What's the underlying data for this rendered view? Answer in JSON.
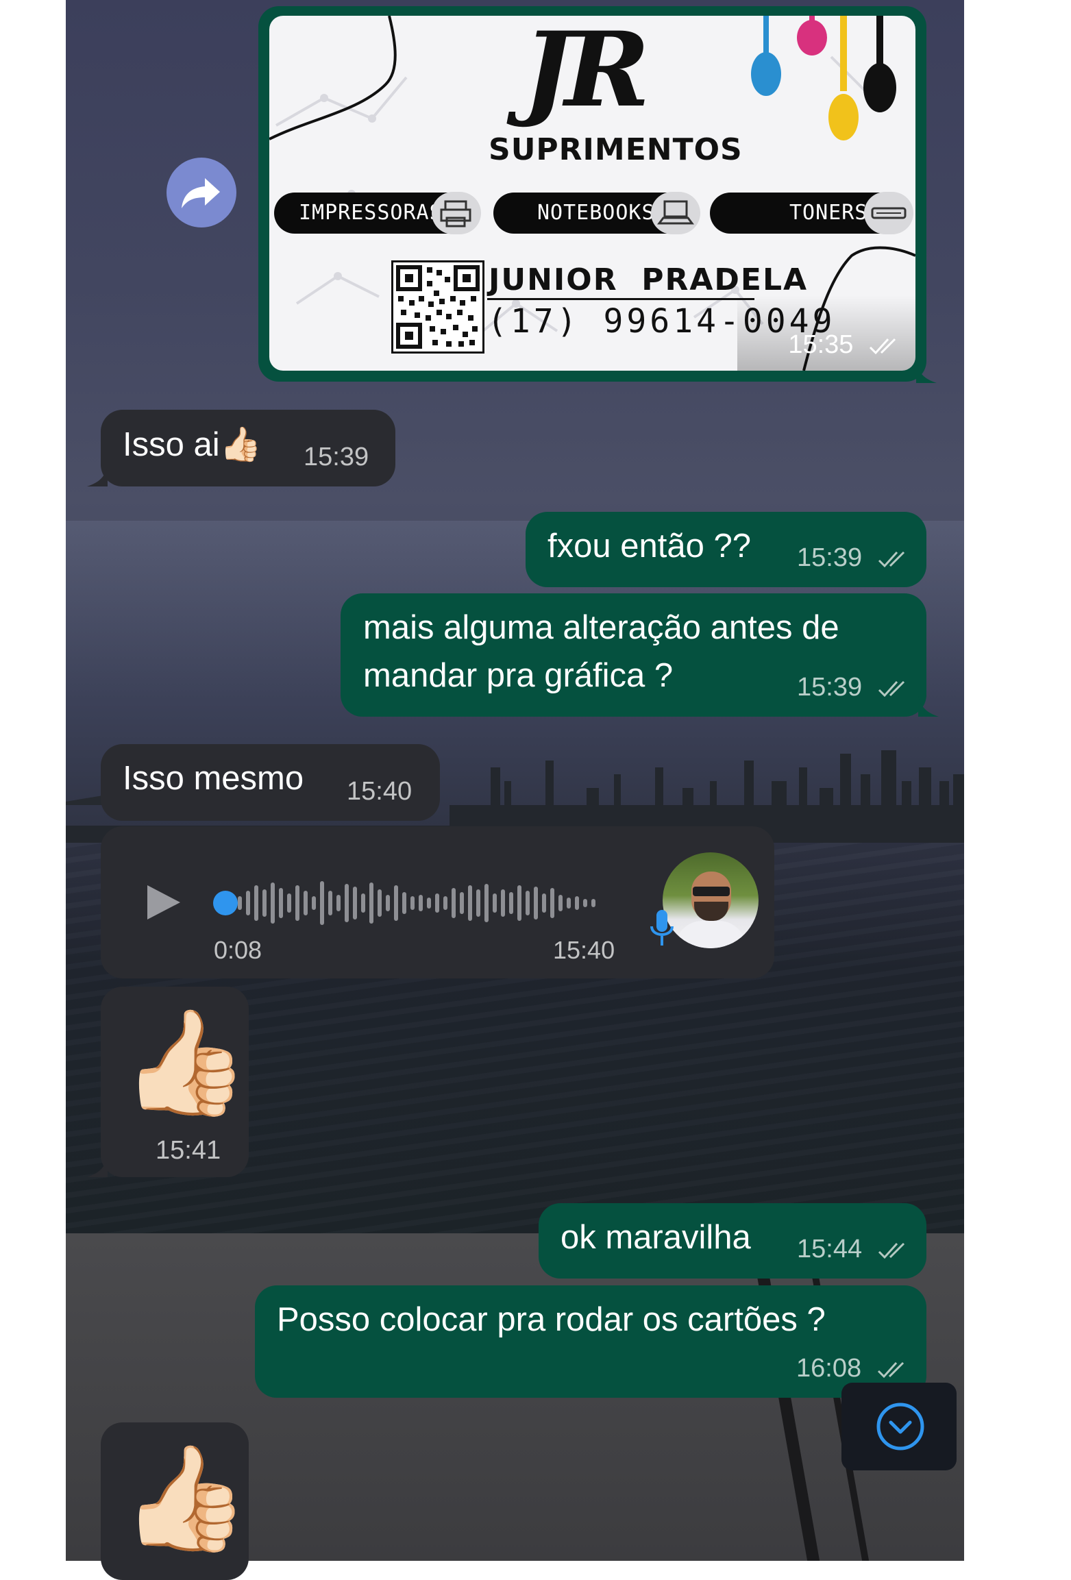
{
  "card": {
    "brand_logo": "JR",
    "brand_name": "SUPRIMENTOS",
    "categories": [
      "IMPRESSORAS",
      "NOTEBOOKS",
      "TONERS"
    ],
    "contact_name": "JUNIOR  PRADELA",
    "contact_phone": "(17) 99614-0049",
    "time": "15:35"
  },
  "messages": [
    {
      "text": "Isso ai👍🏻",
      "time": "15:39"
    },
    {
      "text": "fxou então ??",
      "time": "15:39"
    },
    {
      "line1": "mais alguma alteração antes de",
      "line2": "mandar pra gráfica ?",
      "time": "15:39"
    },
    {
      "text": "Isso mesmo",
      "time": "15:40"
    },
    {
      "duration": "0:08",
      "time": "15:40"
    },
    {
      "emoji": "👍🏻",
      "time": "15:41"
    },
    {
      "text": "ok maravilha",
      "time": "15:44"
    },
    {
      "text": "Posso colocar pra rodar os cartões ?",
      "time": "16:08"
    },
    {
      "emoji": "👍🏻"
    }
  ],
  "colors": {
    "outgoing": "#05513f",
    "incoming": "#2a2b30",
    "forward_button": "#7b8ad0",
    "voice_accent": "#2f95ee"
  },
  "icons": [
    "forward-icon",
    "double-check-icon",
    "play-icon",
    "microphone-icon",
    "chevron-down-icon"
  ]
}
